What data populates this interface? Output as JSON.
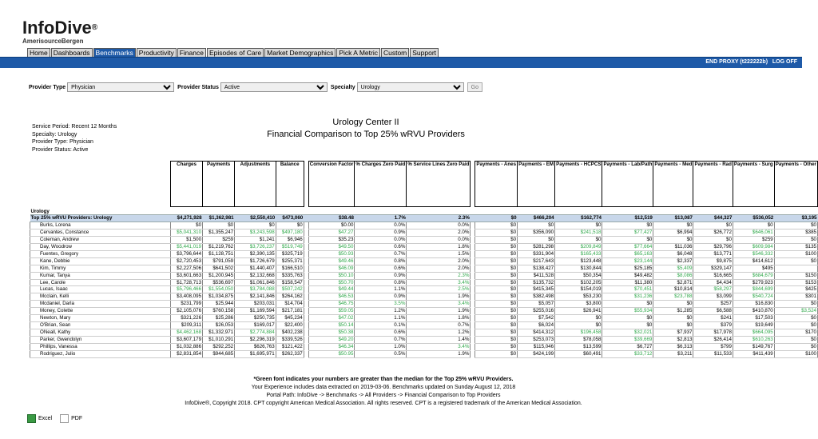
{
  "logo": {
    "name": "InfoDive",
    "reg": "®",
    "company": "AmerisourceBergen"
  },
  "nav": [
    "Home",
    "Dashboards",
    "Benchmarks",
    "Productivity",
    "Finance",
    "Episodes of Care",
    "Market Demographics",
    "Pick A Metric",
    "Custom",
    "Support"
  ],
  "nav_active": "Benchmarks",
  "topbar": {
    "proxy": "END PROXY (t222222b)",
    "logoff": "LOG OFF"
  },
  "filters": {
    "provider_type_label": "Provider Type",
    "provider_type": "Physician",
    "provider_status_label": "Provider Status",
    "provider_status": "Active",
    "specialty_label": "Specialty",
    "specialty": "Urology",
    "go": "Go"
  },
  "meta": [
    "Service Period: Recent 12 Months",
    "Specialty: Urology",
    "Provider Type: Physician",
    "Provider Status: Active"
  ],
  "title": "Urology Center II",
  "subtitle": "Financial Comparison to Top 25% wRVU Providers",
  "columns": {
    "g1": [
      "Charges",
      "Payments",
      "Adjustments",
      "Balance"
    ],
    "g2": [
      "Conversion Factor",
      "% Charges Zero Paid",
      "% Service Lines Zero Paid"
    ],
    "g3": [
      "Payments - Anes",
      "Payments - EM",
      "Payments - HCPCS",
      "Payments - Lab/Path",
      "Payments - Med",
      "Payments - Rad",
      "Payments - Surg",
      "Payments - Other"
    ]
  },
  "section": "Urology",
  "top": {
    "name": "Top 25% wRVU Providers: Urology",
    "v": [
      "$4,271,928",
      "$1,362,981",
      "$2,550,410",
      "$473,060",
      "$38.48",
      "1.7%",
      "2.3%",
      "$0",
      "$466,204",
      "$162,774",
      "$12,519",
      "$13,087",
      "$44,327",
      "$536,052",
      "$3,195"
    ]
  },
  "rows": [
    {
      "name": "Burks, Lorena",
      "v": [
        "$0",
        "$0",
        "$0",
        "$0",
        "$0.00",
        "0.0%",
        "0.0%",
        "$0",
        "$0",
        "$0",
        "$0",
        "$0",
        "$0",
        "$0",
        "$0"
      ],
      "g": []
    },
    {
      "name": "Cervantes, Constance",
      "v": [
        "$5,041,310",
        "$1,355,247",
        "$3,243,598",
        "$497,180",
        "$47.27",
        "0.9%",
        "2.0%",
        "$0",
        "$356,090",
        "$241,518",
        "$77,427",
        "$6,994",
        "$26,772",
        "$646,061",
        "$385"
      ],
      "g": [
        0,
        2,
        3,
        4,
        9,
        10,
        13
      ]
    },
    {
      "name": "Coleman, Andrew",
      "v": [
        "$1,500",
        "$259",
        "$1,241",
        "$6,946",
        "$35.23",
        "0.0%",
        "0.0%",
        "$0",
        "$0",
        "$0",
        "$0",
        "$0",
        "$0",
        "$259",
        "$0"
      ],
      "g": []
    },
    {
      "name": "Day, Woodrow",
      "v": [
        "$5,441,019",
        "$1,219,762",
        "$3,726,237",
        "$519,749",
        "$49.50",
        "0.6%",
        "1.8%",
        "$0",
        "$281,298",
        "$209,849",
        "$77,664",
        "$11,036",
        "$29,796",
        "$609,984",
        "$135"
      ],
      "g": [
        0,
        2,
        3,
        4,
        9,
        10,
        13
      ]
    },
    {
      "name": "Fuentes, Gregory",
      "v": [
        "$3,796,644",
        "$1,128,751",
        "$2,390,135",
        "$325,719",
        "$50.93",
        "0.7%",
        "1.5%",
        "$0",
        "$331,904",
        "$165,433",
        "$65,163",
        "$6,048",
        "$13,771",
        "$546,332",
        "$100"
      ],
      "g": [
        4,
        9,
        10,
        13
      ]
    },
    {
      "name": "Kane, Debbie",
      "v": [
        "$2,720,453",
        "$791,059",
        "$1,726,679",
        "$255,371",
        "$49.46",
        "0.8%",
        "2.0%",
        "$0",
        "$217,643",
        "$123,448",
        "$23,144",
        "$2,337",
        "$9,875",
        "$414,612",
        "$0"
      ],
      "g": [
        4,
        10
      ]
    },
    {
      "name": "Kim, Timmy",
      "v": [
        "$2,227,506",
        "$641,502",
        "$1,440,407",
        "$166,510",
        "$46.09",
        "0.6%",
        "2.0%",
        "$0",
        "$138,427",
        "$130,844",
        "$25,185",
        "$5,409",
        "$329,147",
        "$495"
      ],
      "g": [
        4,
        11
      ],
      "fix": true
    },
    {
      "name": "Kumar, Tanya",
      "v": [
        "$3,601,663",
        "$1,200,945",
        "$2,132,668",
        "$335,763",
        "$50.10",
        "0.9%",
        "2.3%",
        "$0",
        "$411,528",
        "$50,354",
        "$49,482",
        "$8,086",
        "$16,665",
        "$684,679",
        "$150"
      ],
      "g": [
        4,
        6,
        11,
        13
      ]
    },
    {
      "name": "Lee, Carole",
      "v": [
        "$1,728,713",
        "$536,697",
        "$1,061,846",
        "$158,547",
        "$50.70",
        "0.8%",
        "3.4%",
        "$0",
        "$135,732",
        "$102,205",
        "$11,380",
        "$2,871",
        "$4,434",
        "$279,923",
        "$153"
      ],
      "g": [
        4,
        6
      ]
    },
    {
      "name": "Lucas, Isaac",
      "v": [
        "$5,796,466",
        "$1,554,050",
        "$3,784,088",
        "$507,242",
        "$49.44",
        "1.1%",
        "2.5%",
        "$0",
        "$415,345",
        "$154,019",
        "$70,451",
        "$10,814",
        "$58,297",
        "$844,699",
        "$425"
      ],
      "g": [
        0,
        1,
        2,
        3,
        4,
        6,
        10,
        12,
        13
      ]
    },
    {
      "name": "Mcclain, Kelli",
      "v": [
        "$3,408,095",
        "$1,034,875",
        "$2,141,846",
        "$264,162",
        "$46.53",
        "0.9%",
        "1.9%",
        "$0",
        "$382,498",
        "$53,230",
        "$31,236",
        "$23,788",
        "$3,099",
        "$540,724",
        "$301"
      ],
      "g": [
        4,
        10,
        11,
        13
      ]
    },
    {
      "name": "Mcdaniel, Darla",
      "v": [
        "$231,799",
        "$25,944",
        "$203,031",
        "$14,704",
        "$46.75",
        "3.5%",
        "3.4%",
        "$0",
        "$5,057",
        "$3,800",
        "$0",
        "$0",
        "$257",
        "$16,830",
        "$0"
      ],
      "g": [
        4,
        5,
        6
      ]
    },
    {
      "name": "Money, Colette",
      "v": [
        "$2,105,076",
        "$760,158",
        "$1,169,594",
        "$217,181",
        "$59.05",
        "1.2%",
        "1.9%",
        "$0",
        "$255,016",
        "$26,941",
        "$55,934",
        "$1,285",
        "$6,588",
        "$410,870",
        "$3,524"
      ],
      "g": [
        4,
        10,
        14
      ]
    },
    {
      "name": "Newton, Mary",
      "v": [
        "$321,226",
        "$25,286",
        "$250,735",
        "$45,234",
        "$47.02",
        "1.1%",
        "1.8%",
        "$0",
        "$7,542",
        "$0",
        "$0",
        "$0",
        "$241",
        "$17,503",
        "$0"
      ],
      "g": [
        4
      ]
    },
    {
      "name": "O'Brian, Sean",
      "v": [
        "$209,311",
        "$26,053",
        "$169,017",
        "$22,400",
        "$50.14",
        "0.1%",
        "0.7%",
        "$0",
        "$6,024",
        "$0",
        "$0",
        "$0",
        "$379",
        "$19,649",
        "$0"
      ],
      "g": [
        4
      ]
    },
    {
      "name": "ONeall, Kathy",
      "v": [
        "$4,462,168",
        "$1,332,971",
        "$2,774,884",
        "$402,238",
        "$50.38",
        "0.6%",
        "1.2%",
        "$0",
        "$414,312",
        "$196,458",
        "$32,021",
        "$7,937",
        "$17,978",
        "$664,095",
        "$170"
      ],
      "g": [
        0,
        2,
        4,
        9,
        10,
        13
      ]
    },
    {
      "name": "Parker, Gwendolyn",
      "v": [
        "$3,607,179",
        "$1,010,291",
        "$2,296,319",
        "$339,526",
        "$49.20",
        "0.7%",
        "1.4%",
        "$0",
        "$253,073",
        "$78,058",
        "$39,669",
        "$2,813",
        "$26,414",
        "$610,263",
        "$0"
      ],
      "g": [
        4,
        10,
        13
      ]
    },
    {
      "name": "Phillips, Vanessa",
      "v": [
        "$1,032,886",
        "$292,252",
        "$626,763",
        "$121,422",
        "$46.34",
        "1.0%",
        "3.4%",
        "$0",
        "$115,046",
        "$13,599",
        "$6,727",
        "$6,313",
        "$799",
        "$149,767",
        "$0"
      ],
      "g": [
        4,
        6
      ]
    },
    {
      "name": "Rodriguez, Julio",
      "v": [
        "$2,831,854",
        "$944,685",
        "$1,695,971",
        "$262,337",
        "$50.95",
        "0.5%",
        "1.9%",
        "$0",
        "$424,199",
        "$60,491",
        "$33,712",
        "$3,211",
        "$11,533",
        "$411,439",
        "$100"
      ],
      "g": [
        4,
        10
      ]
    }
  ],
  "footer": [
    "*Green font indicates your numbers are greater than the median for the Top 25% wRVU Providers.",
    "Your Experience includes data extracted on 2019-03-06. Benchmarks updated on Sunday August 12, 2018",
    "Portal Path: InfoDive -> Benchmarks -> All Providers -> Financial Comparison to Top Providers",
    "InfoDive®, Copyright 2018.  CPT copyright American Medical Association.  All rights reserved. CPT is a registered trademark of the American Medical Association."
  ],
  "exports": {
    "excel": "Excel",
    "pdf": "PDF"
  },
  "colors": {
    "brand_blue": "#1e5aa8",
    "top_row": "#c8d7ea",
    "green": "#2fa84a"
  }
}
